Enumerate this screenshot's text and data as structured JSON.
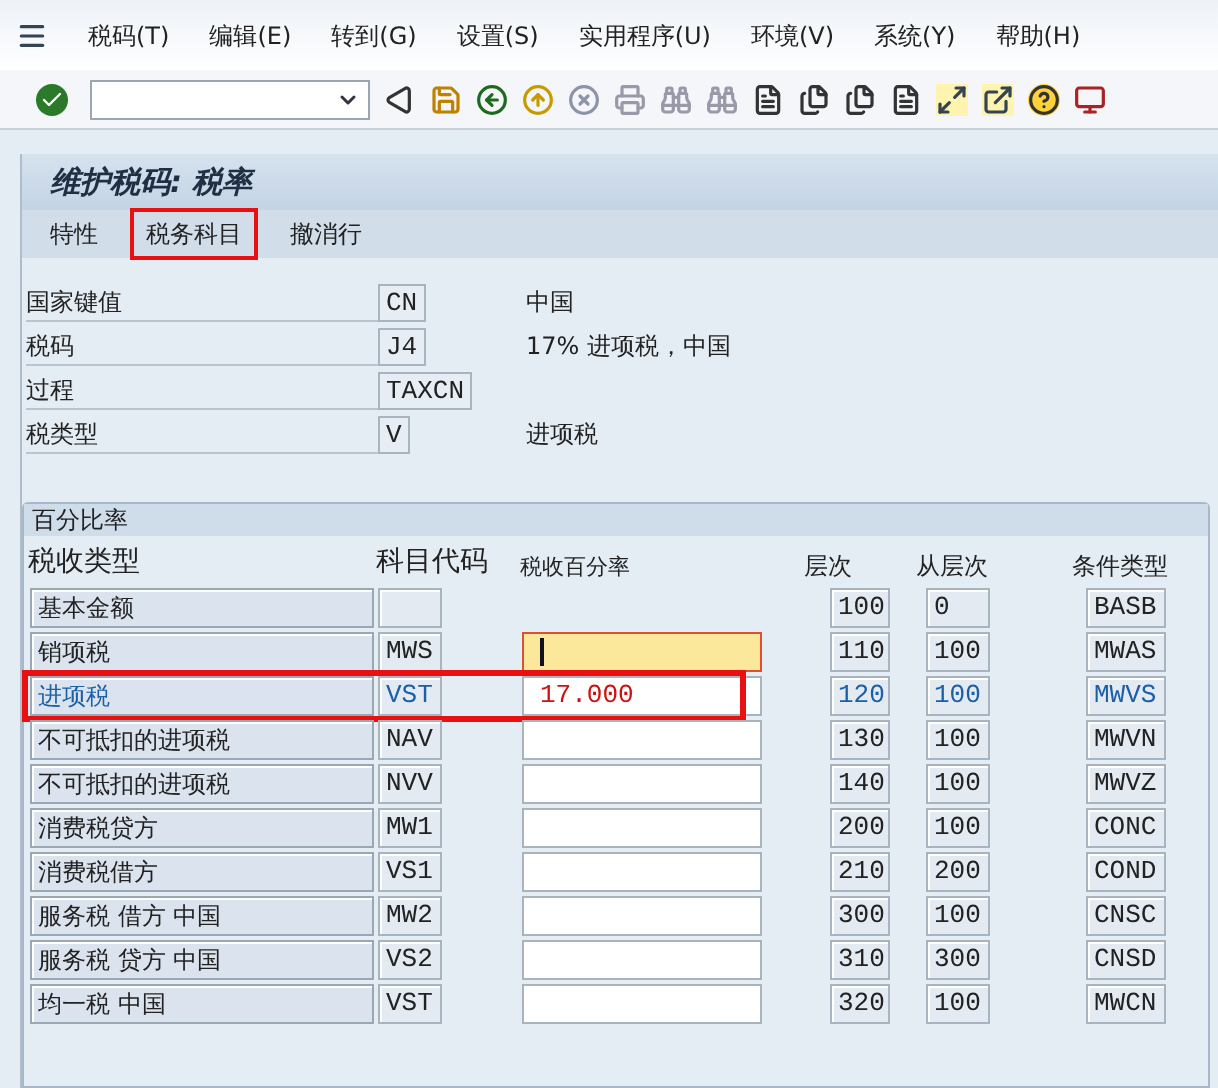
{
  "menu": [
    "税码(T)",
    "编辑(E)",
    "转到(G)",
    "设置(S)",
    "实用程序(U)",
    "环境(V)",
    "系统(Y)",
    "帮助(H)"
  ],
  "title": "维护税码: 税率",
  "tabs": [
    {
      "label": "特性",
      "highlighted": false
    },
    {
      "label": "税务科目",
      "highlighted": true
    },
    {
      "label": "撤消行",
      "highlighted": false
    }
  ],
  "header": [
    {
      "label": "国家键值",
      "value": "CN",
      "description": "中国"
    },
    {
      "label": "税码",
      "value": "J4",
      "description": "17% 进项税，中国"
    },
    {
      "label": "过程",
      "value": "TAXCN"
    },
    {
      "label": "税类型",
      "value": "V",
      "description": "进项税"
    }
  ],
  "group": {
    "title": "百分比率",
    "columns": [
      "税收类型",
      "科目代码",
      "税收百分率",
      "层次",
      "从层次",
      "条件类型"
    ],
    "rows": [
      {
        "kind": "base",
        "type": "基本金额",
        "code": "",
        "level": "100",
        "from_level": "0",
        "condition": "BASB",
        "highlighted": false
      },
      {
        "kind": "rate",
        "type": "销项税",
        "code": "MWS",
        "percent": "",
        "level": "110",
        "from_level": "100",
        "condition": "MWAS",
        "highlighted": false,
        "focused": true
      },
      {
        "kind": "rate",
        "type": "进项税",
        "code": "VST",
        "percent": "17.000",
        "level": "120",
        "from_level": "100",
        "condition": "MWVS",
        "highlighted": true,
        "focused": false
      },
      {
        "kind": "rate",
        "type": "不可抵扣的进项税",
        "code": "NAV",
        "percent": "",
        "level": "130",
        "from_level": "100",
        "condition": "MWVN",
        "highlighted": false,
        "focused": false
      },
      {
        "kind": "rate",
        "type": "不可抵扣的进项税",
        "code": "NVV",
        "percent": "",
        "level": "140",
        "from_level": "100",
        "condition": "MWVZ",
        "highlighted": false,
        "focused": false
      },
      {
        "kind": "rate",
        "type": "消费税贷方",
        "code": "MW1",
        "percent": "",
        "level": "200",
        "from_level": "100",
        "condition": "CONC",
        "highlighted": false,
        "focused": false
      },
      {
        "kind": "rate",
        "type": "消费税借方",
        "code": "VS1",
        "percent": "",
        "level": "210",
        "from_level": "200",
        "condition": "COND",
        "highlighted": false,
        "focused": false
      },
      {
        "kind": "rate",
        "type": "服务税 借方 中国",
        "code": "MW2",
        "percent": "",
        "level": "300",
        "from_level": "100",
        "condition": "CNSC",
        "highlighted": false,
        "focused": false
      },
      {
        "kind": "rate",
        "type": "服务税 贷方 中国",
        "code": "VS2",
        "percent": "",
        "level": "310",
        "from_level": "300",
        "condition": "CNSD",
        "highlighted": false,
        "focused": false
      },
      {
        "kind": "rate",
        "type": "均一税 中国",
        "code": "VST",
        "percent": "",
        "level": "320",
        "from_level": "100",
        "condition": "MWCN",
        "highlighted": false,
        "focused": false
      }
    ]
  }
}
